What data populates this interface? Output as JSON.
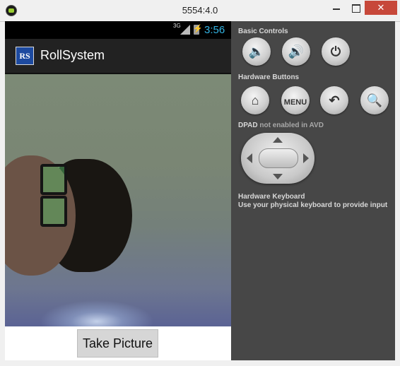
{
  "window": {
    "title": "5554:4.0",
    "minimize_icon": "minimize-icon",
    "maximize_icon": "maximize-icon",
    "close_icon": "close-icon",
    "close_glyph": "✕"
  },
  "status_bar": {
    "network": "3G",
    "time": "3:56"
  },
  "action_bar": {
    "logo_text": "RS",
    "app_name": "RollSystem"
  },
  "main": {
    "take_picture_label": "Take Picture"
  },
  "controls": {
    "basic_controls_label": "Basic Controls",
    "basic_buttons": [
      {
        "icon": "volume-down-icon",
        "glyph": "🔈"
      },
      {
        "icon": "volume-up-icon",
        "glyph": "🔊"
      },
      {
        "icon": "power-icon",
        "glyph": "⏻"
      }
    ],
    "hardware_buttons_label": "Hardware Buttons",
    "hardware_buttons": [
      {
        "icon": "home-icon",
        "glyph": "⌂"
      },
      {
        "icon": "menu-icon",
        "label": "MENU"
      },
      {
        "icon": "back-icon",
        "glyph": "↶"
      },
      {
        "icon": "search-icon",
        "glyph": "🔍"
      }
    ],
    "dpad_label": "DPAD",
    "dpad_note": "not enabled in AVD",
    "keyboard_label": "Hardware Keyboard",
    "keyboard_hint": "Use your physical keyboard to provide input"
  },
  "colors": {
    "clock": "#33b5e5",
    "panel_bg": "#474747",
    "close_button": "#c7483a"
  }
}
